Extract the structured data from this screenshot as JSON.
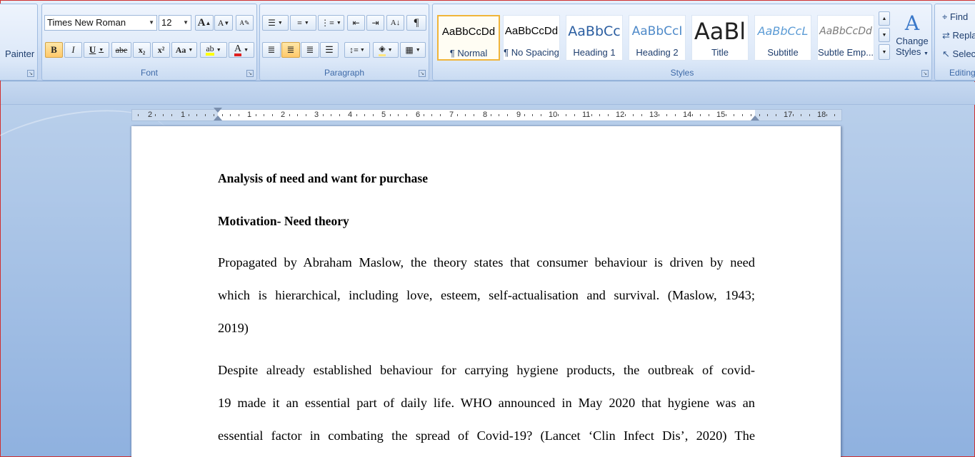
{
  "ribbon": {
    "clipboard": {
      "format_painter": "Painter"
    },
    "font": {
      "label": "Font",
      "font_name": "Times New Roman",
      "font_size": "12",
      "bold": "B",
      "italic": "I",
      "underline": "U",
      "strike": "abe",
      "subscript": "x₂",
      "superscript": "x²",
      "change_case": "Aa",
      "grow": "A",
      "shrink": "A"
    },
    "paragraph": {
      "label": "Paragraph",
      "pilcrow": "¶"
    },
    "styles": {
      "label": "Styles",
      "items": [
        {
          "sample": "AaBbCcDd",
          "name": "¶ Normal"
        },
        {
          "sample": "AaBbCcDd",
          "name": "¶ No Spacing"
        },
        {
          "sample": "AaBbCc",
          "name": "Heading 1"
        },
        {
          "sample": "AaBbCcI",
          "name": "Heading 2"
        },
        {
          "sample": "AaBl",
          "name": "Title"
        },
        {
          "sample": "AaBbCcL",
          "name": "Subtitle"
        },
        {
          "sample": "AaBbCcDd",
          "name": "Subtle Emp..."
        }
      ],
      "change_styles_1": "Change",
      "change_styles_2": "Styles"
    },
    "editing": {
      "label": "Editing",
      "find": "Find",
      "replace": "Repla",
      "select": "Selec"
    }
  },
  "ruler": {
    "numbers": [
      "2",
      "1",
      "1",
      "2",
      "3",
      "4",
      "5",
      "6",
      "7",
      "8",
      "9",
      "10",
      "11",
      "12",
      "13",
      "14",
      "15",
      "17",
      "18"
    ]
  },
  "document": {
    "title": "Analysis of need and want for purchase",
    "subheading": "Motivation- Need theory",
    "paragraph1": [
      "Propagated by Abraham Maslow, the theory states that consumer behaviour is driven by need",
      "which is hierarchical, including love, esteem, self-actualisation and survival. (Maslow, 1943;",
      "2019)"
    ],
    "paragraph2": [
      "Despite already established behaviour for carrying hygiene products, the outbreak of covid-",
      "19 made it an essential part of daily life.  WHO announced in May 2020 that hygiene was an",
      "essential factor in combating the spread of Covid-19? (Lancet ‘Clin Infect Dis’, 2020) The"
    ]
  }
}
